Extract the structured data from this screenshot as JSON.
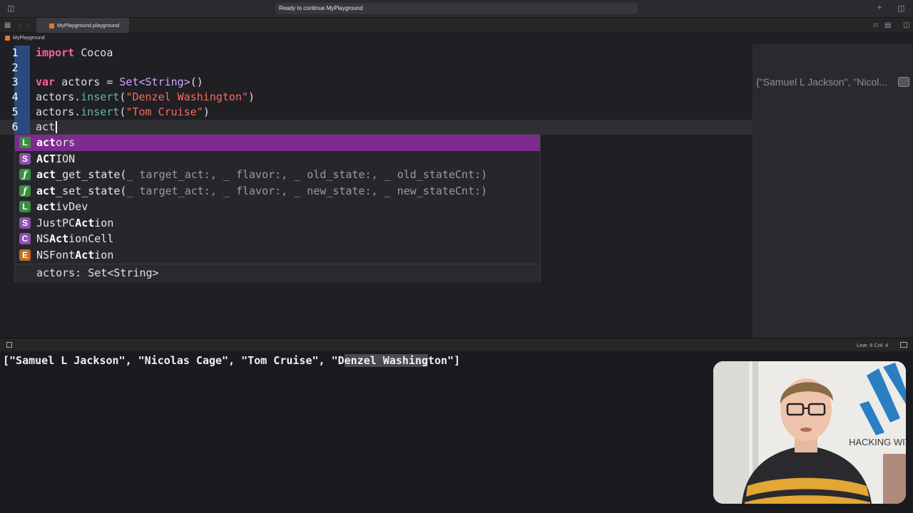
{
  "window": {
    "status": "Ready to continue MyPlayground"
  },
  "tab": {
    "label": "MyPlayground.playground"
  },
  "breadcrumb": {
    "label": "MyPlayground"
  },
  "editor": {
    "lines": [
      {
        "num": "1"
      },
      {
        "num": "2"
      },
      {
        "num": "3"
      },
      {
        "num": "4"
      },
      {
        "num": "5"
      },
      {
        "num": "6"
      }
    ],
    "code": {
      "l1_kw": "import",
      "l1_rest": " Cocoa",
      "l3_kw": "var",
      "l3_rest": " actors = ",
      "l3_type": "Set<String>",
      "l3_tail": "()",
      "l4_a": "actors.",
      "l4_fn": "insert",
      "l4_p1": "(",
      "l4_str": "\"Denzel Washington\"",
      "l4_p2": ")",
      "l5_a": "actors.",
      "l5_fn": "insert",
      "l5_p1": "(",
      "l5_str": "\"Tom Cruise\"",
      "l5_p2": ")",
      "l6": "act"
    }
  },
  "side_result": "{\"Samuel L Jackson\", \"Nicol...",
  "completion": {
    "items": [
      {
        "kind": "L",
        "match": "act",
        "rest": "ors"
      },
      {
        "kind": "S",
        "match": "ACT",
        "rest": "ION"
      },
      {
        "kind": "F",
        "match": "act",
        "rest": "_get_state(",
        "params": "_ target_act:, _ flavor:, _ old_state:, _ old_stateCnt:)"
      },
      {
        "kind": "F",
        "match": "act",
        "rest": "_set_state(",
        "params": "_ target_act:, _ flavor:, _ new_state:, _ new_stateCnt:)"
      },
      {
        "kind": "L",
        "match": "act",
        "rest": "ivDev"
      },
      {
        "kind": "S",
        "pre": "JustPC",
        "match": "Act",
        "rest": "ion"
      },
      {
        "kind": "C",
        "pre": "NS",
        "match": "Act",
        "rest": "ionCell"
      },
      {
        "kind": "E",
        "pre": "NSFont",
        "match": "Act",
        "rest": "ion"
      }
    ],
    "detail": "actors: Set<String>"
  },
  "debug": {
    "position": "Line: 6  Col: 4"
  },
  "console": {
    "pre": "[\"Samuel L Jackson\", \"Nicolas Cage\", \"Tom Cruise\", \"D",
    "highlight": "enzel Washing",
    "post": "ton\"]"
  },
  "webcam": {
    "shirt_text": "HACKING WIT"
  },
  "colors": {
    "selection": "#7d2b8f",
    "line_number_highlight": "#2a4a7f",
    "keyword": "#fc5fa3",
    "string": "#fc6a5d"
  }
}
